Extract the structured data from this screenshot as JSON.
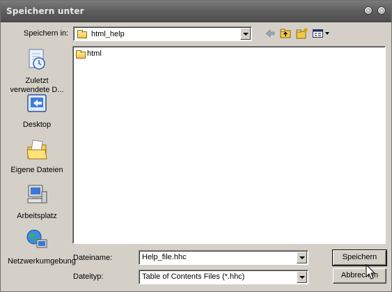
{
  "window": {
    "title": "Speichern unter"
  },
  "toolbar": {
    "save_in_label": "Speichern in:",
    "current_folder": "html_help",
    "icons": [
      "back-arrow-icon",
      "folder-up-icon",
      "new-folder-icon",
      "view-menu-icon"
    ]
  },
  "sidebar": {
    "items": [
      {
        "label": "Zuletzt verwendete D...",
        "icon": "recent-documents-icon"
      },
      {
        "label": "Desktop",
        "icon": "desktop-icon"
      },
      {
        "label": "Eigene Dateien",
        "icon": "my-documents-icon"
      },
      {
        "label": "Arbeitsplatz",
        "icon": "my-computer-icon"
      },
      {
        "label": "Netzwerkumgebung",
        "icon": "network-icon"
      }
    ]
  },
  "files": [
    {
      "name": "html",
      "type": "folder"
    }
  ],
  "filename": {
    "label": "Dateiname:",
    "value": "Help_file.hhc"
  },
  "filetype": {
    "label": "Dateityp:",
    "value": "Table of Contents Files (*.hhc)"
  },
  "buttons": {
    "save": "Speichern",
    "cancel": "Abbrechen"
  }
}
